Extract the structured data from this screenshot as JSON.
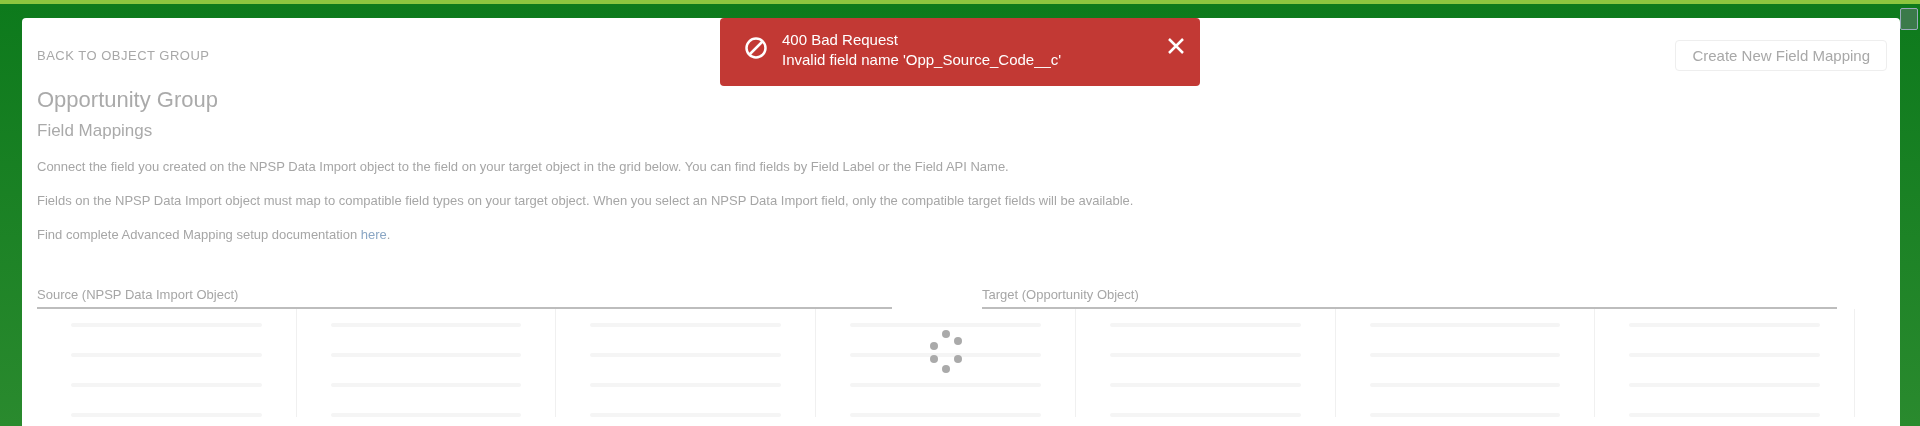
{
  "toast": {
    "title": "400 Bad Request",
    "message": "Invalid field name 'Opp_Source_Code__c'"
  },
  "back_link": "BACK TO OBJECT GROUP",
  "create_button": "Create New Field Mapping",
  "title": "Opportunity Group",
  "subtitle": "Field Mappings",
  "paragraphs": [
    {
      "text": "Connect the field you created on the NPSP Data Import object to the field on your target object in the grid below. You can find fields by Field Label or the Field API Name."
    },
    {
      "text": "Fields on the NPSP Data Import object must map to compatible field types on your target object. When you select an NPSP Data Import field, only the compatible target fields will be available."
    },
    {
      "text": "Find complete Advanced Mapping setup documentation ",
      "link": "here",
      "after": "."
    }
  ],
  "columns": [
    {
      "label": "Source (NPSP Data Import Object)"
    },
    {
      "label": "Target (Opportunity Object)"
    }
  ],
  "loading": true
}
